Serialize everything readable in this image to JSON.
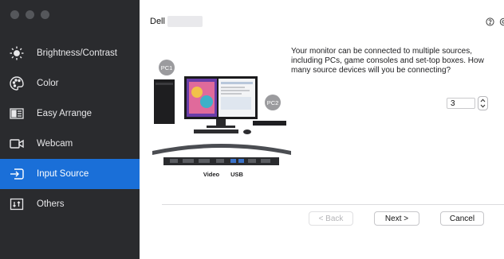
{
  "window": {
    "title_dots": [
      "close",
      "minimize",
      "zoom"
    ]
  },
  "sidebar": {
    "items": [
      {
        "label": "Brightness/Contrast",
        "icon": "brightness-icon",
        "active": false
      },
      {
        "label": "Color",
        "icon": "palette-icon",
        "active": false
      },
      {
        "label": "Easy Arrange",
        "icon": "easy-arrange-icon",
        "active": false
      },
      {
        "label": "Webcam",
        "icon": "webcam-icon",
        "active": false
      },
      {
        "label": "Input Source",
        "icon": "input-source-icon",
        "active": true
      },
      {
        "label": "Others",
        "icon": "others-icon",
        "active": false
      }
    ]
  },
  "header": {
    "brand": "Dell"
  },
  "top_icons": [
    "help-icon",
    "settings-icon"
  ],
  "illustration": {
    "pc1_label": "PC1",
    "pc2_label": "PC2",
    "port_video": "Video",
    "port_usb": "USB"
  },
  "question": "Your monitor can be connected to multiple sources, including PCs, game consoles and set-top boxes.  How many source devices will you be connecting?",
  "stepper": {
    "value": "3"
  },
  "buttons": {
    "back": "< Back",
    "next": "Next >",
    "cancel": "Cancel"
  },
  "colors": {
    "sidebar_bg": "#2a2b2e",
    "active_bg": "#1a6fd8",
    "dot": "#55575b"
  }
}
